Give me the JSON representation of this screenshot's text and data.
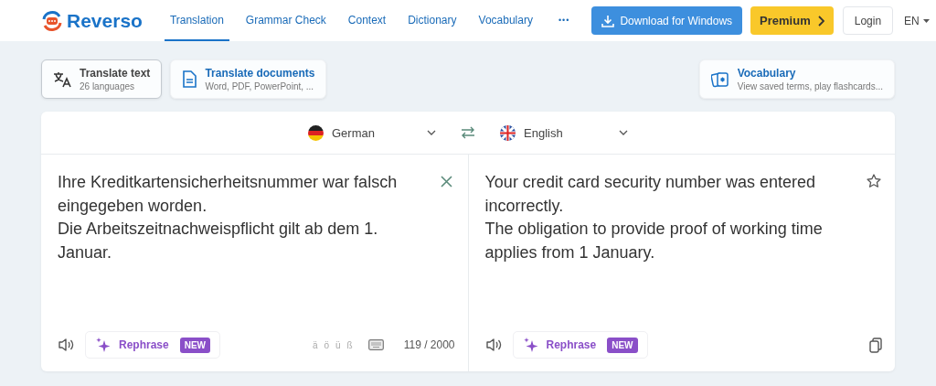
{
  "brand": {
    "name": "Reverso"
  },
  "nav": [
    {
      "label": "Translation",
      "selected": true
    },
    {
      "label": "Grammar Check",
      "selected": false
    },
    {
      "label": "Context",
      "selected": false
    },
    {
      "label": "Dictionary",
      "selected": false
    },
    {
      "label": "Vocabulary",
      "selected": false
    }
  ],
  "more": "•••",
  "download_button": "Download for Windows",
  "premium_button": "Premium",
  "login_button": "Login",
  "language_menu": "EN",
  "modes": [
    {
      "title": "Translate text",
      "subtitle": "26 languages",
      "selected": true
    },
    {
      "title": "Translate documents",
      "subtitle": "Word, PDF, PowerPoint, ...",
      "selected": false
    }
  ],
  "vocabulary_card": {
    "title": "Vocabulary",
    "subtitle": "View saved terms, play flashcards..."
  },
  "source_language": "German",
  "target_language": "English",
  "source": {
    "paragraphs": [
      "Ihre Kreditkartensicherheitsnummer war falsch eingegeben worden.",
      "Die Arbeitszeitnachweispflicht gilt ab dem 1. Januar."
    ],
    "rephrase": {
      "label": "Rephrase",
      "badge": "NEW"
    },
    "special_chars": [
      "ä",
      "ö",
      "ü",
      "ß"
    ],
    "count": "119 / 2000"
  },
  "target": {
    "paragraphs": [
      "Your credit card security number was entered incorrectly.",
      "The obligation to provide proof of working time applies from 1 January."
    ],
    "rephrase": {
      "label": "Rephrase",
      "badge": "NEW"
    }
  }
}
